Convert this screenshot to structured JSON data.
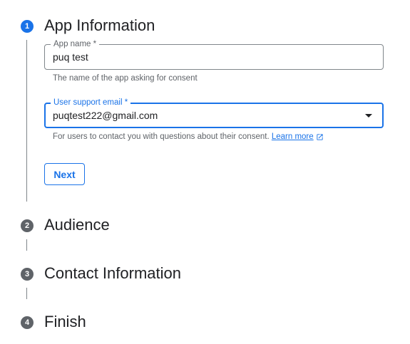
{
  "steps": [
    {
      "number": "1",
      "title": "App Information",
      "state": "active"
    },
    {
      "number": "2",
      "title": "Audience",
      "state": "pending"
    },
    {
      "number": "3",
      "title": "Contact Information",
      "state": "pending"
    },
    {
      "number": "4",
      "title": "Finish",
      "state": "pending"
    }
  ],
  "app_info": {
    "app_name": {
      "label": "App name *",
      "value": "puq test",
      "hint": "The name of the app asking for consent"
    },
    "support_email": {
      "label": "User support email *",
      "value": "puqtest222@gmail.com",
      "hint": "For users to contact you with questions about their consent.",
      "learn_more": "Learn more"
    },
    "next_label": "Next"
  },
  "colors": {
    "accent": "#1a73e8",
    "inactive_step": "#5f6368",
    "text": "#202124",
    "hint": "#5f6368"
  },
  "icons": {
    "dropdown": "chevron-down-icon",
    "external_link": "external-link-icon"
  }
}
